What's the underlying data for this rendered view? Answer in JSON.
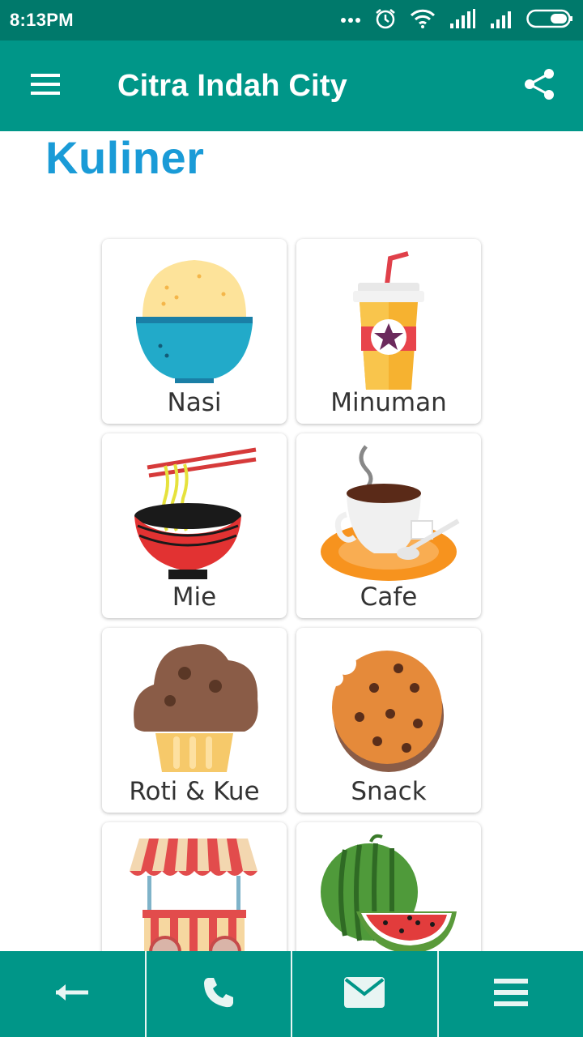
{
  "status_bar": {
    "time": "8:13PM",
    "icons": [
      "more-dots-icon",
      "alarm-icon",
      "wifi-icon",
      "signal-icon",
      "signal-icon",
      "battery-icon"
    ]
  },
  "app_bar": {
    "title": "Citra Indah City",
    "menu_icon": "hamburger-icon",
    "share_icon": "share-icon"
  },
  "page": {
    "heading": "Kuliner"
  },
  "categories": [
    {
      "label": "Nasi",
      "icon": "rice-bowl-icon"
    },
    {
      "label": "Minuman",
      "icon": "drink-cup-icon"
    },
    {
      "label": "Mie",
      "icon": "noodle-bowl-icon"
    },
    {
      "label": "Cafe",
      "icon": "coffee-cup-icon"
    },
    {
      "label": "Roti & Kue",
      "icon": "muffin-icon"
    },
    {
      "label": "Snack",
      "icon": "cookie-icon"
    },
    {
      "label": "",
      "icon": "food-cart-icon"
    },
    {
      "label": "",
      "icon": "watermelon-icon"
    }
  ],
  "bottom_nav": [
    {
      "icon": "back-arrow-icon"
    },
    {
      "icon": "phone-icon"
    },
    {
      "icon": "mail-icon"
    },
    {
      "icon": "menu-lines-icon"
    }
  ],
  "colors": {
    "status_bar": "#00796b",
    "app_bar": "#009688",
    "heading": "#1a9bd7",
    "card_text": "#333333"
  }
}
